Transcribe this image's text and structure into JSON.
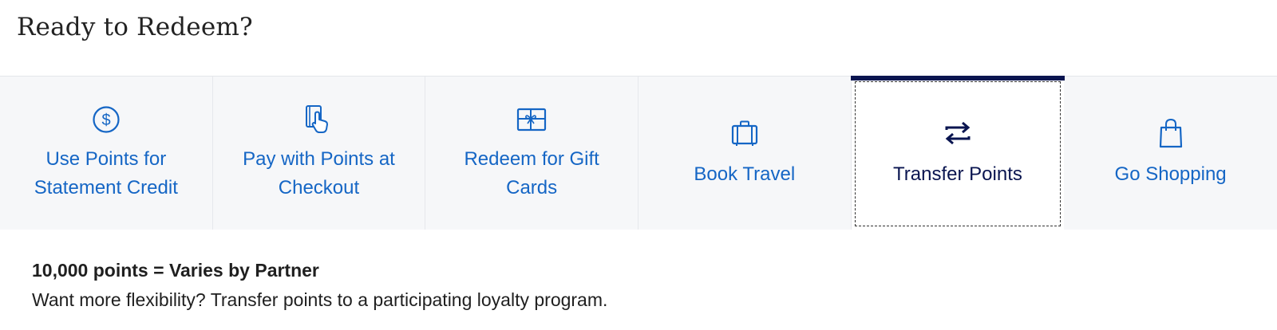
{
  "header": {
    "title": "Ready to Redeem?"
  },
  "tabs": [
    {
      "label": "Use Points for Statement Credit",
      "icon": "dollar-circle-icon"
    },
    {
      "label": "Pay with Points at Checkout",
      "icon": "card-tap-icon"
    },
    {
      "label": "Redeem for Gift Cards",
      "icon": "gift-card-icon"
    },
    {
      "label": "Book Travel",
      "icon": "suitcase-icon"
    },
    {
      "label": "Transfer Points",
      "icon": "transfer-arrows-icon",
      "active": true
    },
    {
      "label": "Go Shopping",
      "icon": "shopping-bag-icon"
    }
  ],
  "details": {
    "headline": "10,000 points = Varies by Partner",
    "description": "Want more flexibility? Transfer points to a participating loyalty program."
  },
  "colors": {
    "link": "#1566c5",
    "active": "#0a1550",
    "tab_bg": "#f6f7f9"
  }
}
